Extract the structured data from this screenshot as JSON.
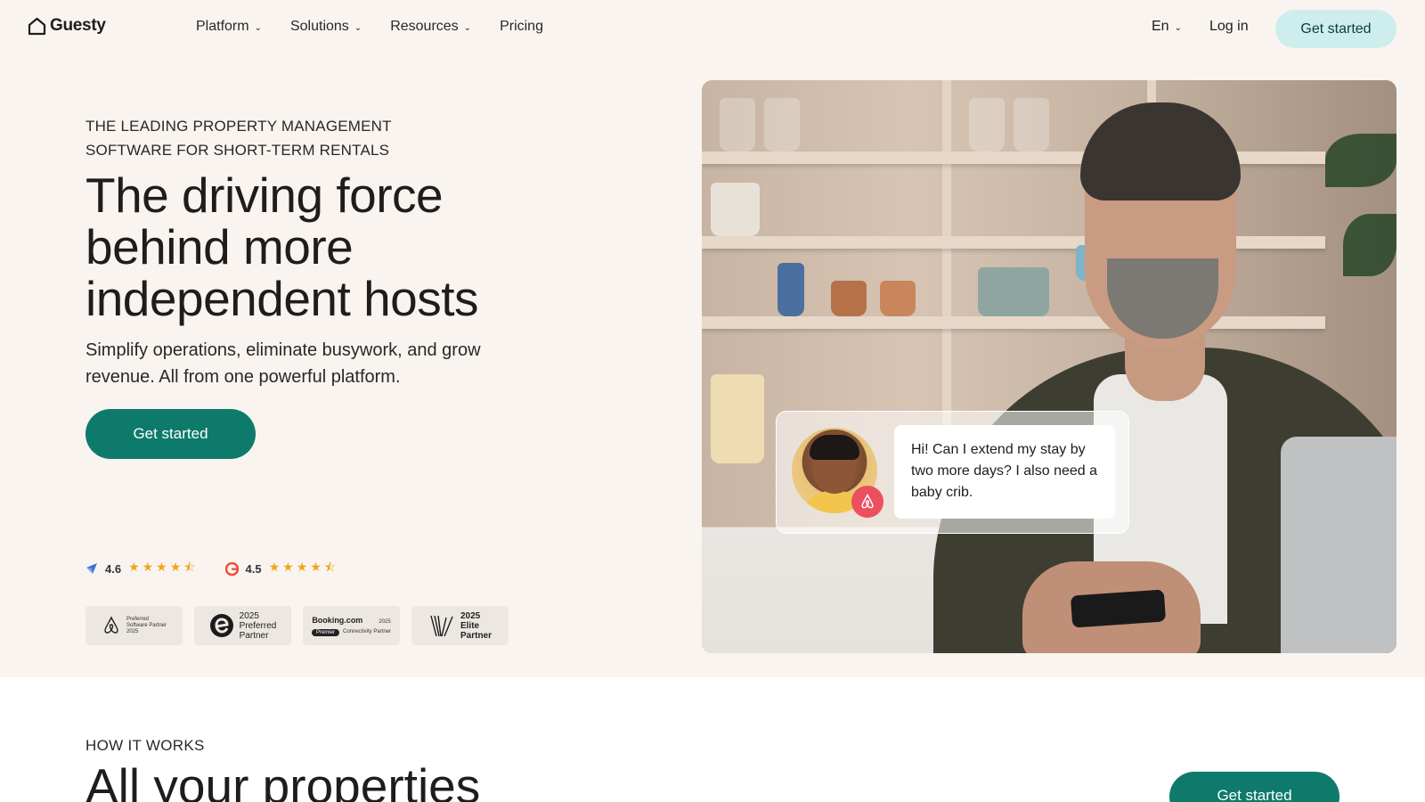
{
  "nav": {
    "brand": "Guesty",
    "links": [
      {
        "label": "Platform",
        "has_menu": true
      },
      {
        "label": "Solutions",
        "has_menu": true
      },
      {
        "label": "Resources",
        "has_menu": true
      },
      {
        "label": "Pricing",
        "has_menu": false
      }
    ],
    "language": "En",
    "login": "Log in",
    "cta": "Get started"
  },
  "hero": {
    "eyebrow": "THE LEADING PROPERTY MANAGEMENT SOFTWARE FOR SHORT-TERM RENTALS",
    "headline": "The driving force behind more independent hosts",
    "subhead": "Simplify operations, eliminate busywork, and grow revenue. All from one powerful platform.",
    "cta": "Get started",
    "ratings": [
      {
        "icon": "capterra-icon",
        "value": "4.6",
        "stars": 4.5
      },
      {
        "icon": "g2-icon",
        "value": "4.5",
        "stars": 4.5
      }
    ],
    "badges": [
      {
        "name": "airbnb",
        "lines": [
          "Preferred",
          "Software Partner",
          "2025"
        ]
      },
      {
        "name": "expedia",
        "lines": [
          "2025",
          "Preferred",
          "Partner"
        ]
      },
      {
        "name": "booking",
        "title": "Booking.com",
        "year": "2025",
        "pill": "Premier",
        "tag": "Connectivity Partner"
      },
      {
        "name": "vrbo",
        "lines": [
          "2025",
          "Elite",
          "Partner"
        ]
      }
    ],
    "chat_message": "Hi! Can I extend my stay by two more days? I also need a baby crib."
  },
  "how": {
    "label": "HOW IT WORKS",
    "title": "All your properties",
    "cta": "Get started"
  },
  "colors": {
    "hero_bg": "#f9f4f0",
    "primary": "#0e7a6b",
    "nav_cta_bg": "#cdeeed",
    "star": "#f2a51a",
    "airbnb": "#ec4f5e"
  }
}
